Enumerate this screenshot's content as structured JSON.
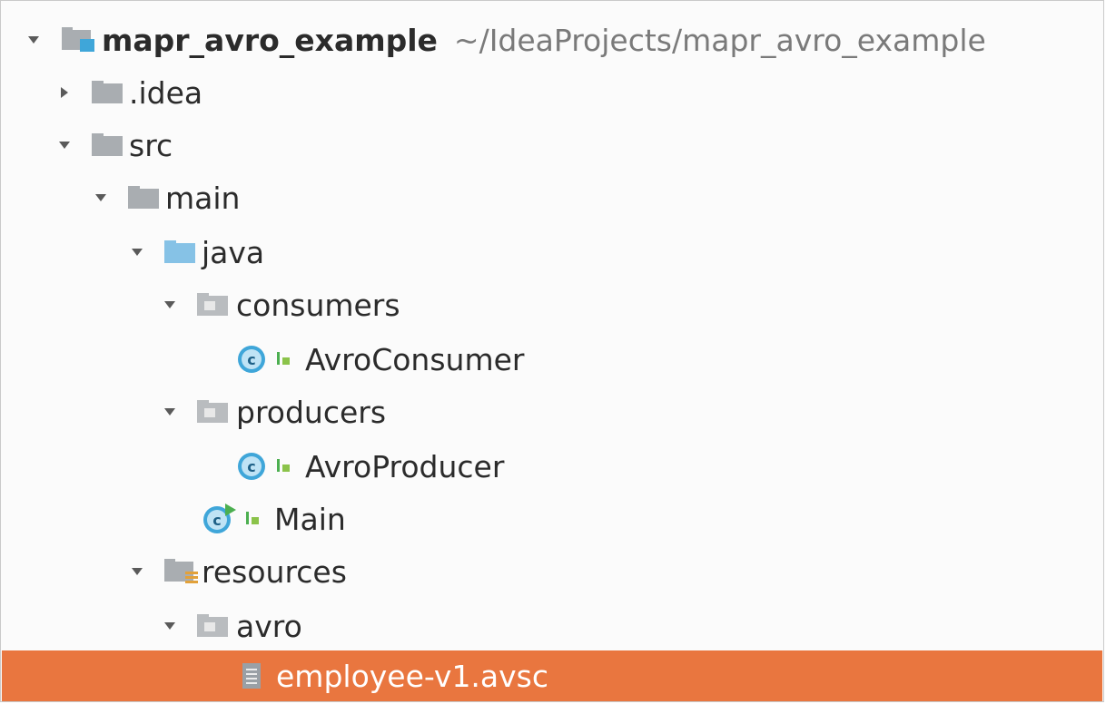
{
  "tree": {
    "root": {
      "label": "mapr_avro_example",
      "path": "~/IdeaProjects/mapr_avro_example"
    },
    "items": [
      {
        "label": ".idea"
      },
      {
        "label": "src"
      },
      {
        "label": "main"
      },
      {
        "label": "java"
      },
      {
        "label": "consumers"
      },
      {
        "label": "AvroConsumer"
      },
      {
        "label": "producers"
      },
      {
        "label": "AvroProducer"
      },
      {
        "label": "Main"
      },
      {
        "label": "resources"
      },
      {
        "label": "avro"
      },
      {
        "label": "employee-v1.avsc"
      }
    ]
  },
  "colors": {
    "selection": "#e9763f",
    "folder": "#a9adb1",
    "source_folder": "#86c2e6",
    "class_icon": "#3fa6d9",
    "runnable_marker": "#4caf50"
  },
  "icons": {
    "expanded": "triangle-down-icon",
    "collapsed": "triangle-right-icon",
    "project": "project-module-icon",
    "folder": "folder-icon",
    "source_folder": "source-folder-icon",
    "package": "package-icon",
    "class": "java-class-icon",
    "main_class": "runnable-class-icon",
    "resources": "resources-folder-icon",
    "file": "text-file-icon"
  }
}
